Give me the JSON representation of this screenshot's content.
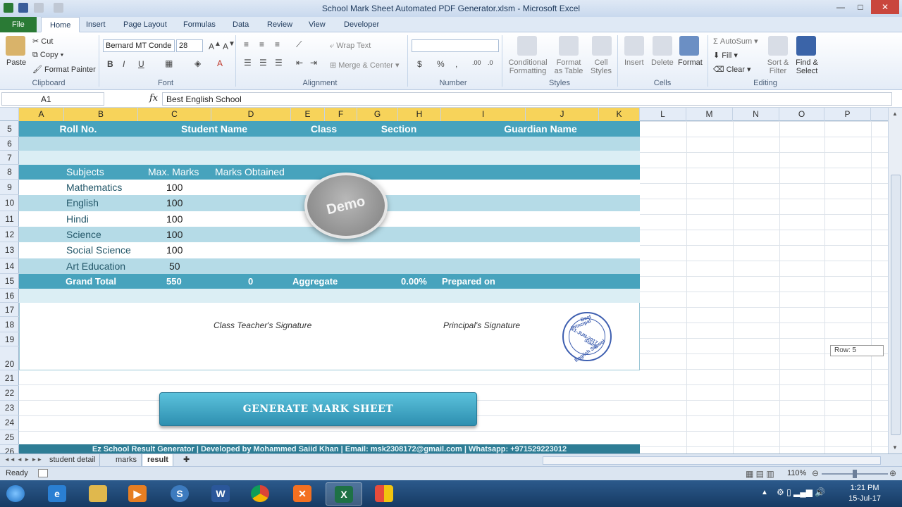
{
  "window": {
    "title": "School Mark Sheet Automated PDF Generator.xlsm  -  Microsoft Excel",
    "minimize": "—",
    "maximize": "□",
    "close": "✕"
  },
  "tabs": [
    "File",
    "Home",
    "Insert",
    "Page Layout",
    "Formulas",
    "Data",
    "Review",
    "View",
    "Developer"
  ],
  "ribbon": {
    "clipboard": {
      "paste": "Paste",
      "cut": "Cut",
      "copy": "Copy",
      "format_painter": "Format Painter",
      "label": "Clipboard"
    },
    "font": {
      "name": "Bernard MT Conde",
      "size": "28",
      "label": "Font",
      "bold": "B",
      "italic": "I",
      "underline": "U"
    },
    "alignment": {
      "wrap": "Wrap Text",
      "merge": "Merge & Center",
      "label": "Alignment"
    },
    "number": {
      "currency": "$",
      "percent": "%",
      "comma": ",",
      "label": "Number"
    },
    "styles": {
      "conditional": "Conditional Formatting",
      "format_table": "Format as Table",
      "cell_styles": "Cell Styles",
      "label": "Styles"
    },
    "cells": {
      "insert": "Insert",
      "delete": "Delete",
      "format": "Format",
      "label": "Cells"
    },
    "editing": {
      "autosum": "AutoSum",
      "fill": "Fill",
      "clear": "Clear",
      "sort": "Sort & Filter",
      "find": "Find & Select",
      "label": "Editing"
    }
  },
  "formula_bar": {
    "cell_ref": "A1",
    "fx": "fx",
    "content": "Best English School"
  },
  "columns": [
    "A",
    "B",
    "C",
    "D",
    "E",
    "F",
    "G",
    "H",
    "I",
    "J",
    "K",
    "L",
    "M",
    "N",
    "O",
    "P"
  ],
  "rows": [
    "5",
    "6",
    "7",
    "8",
    "9",
    "10",
    "11",
    "12",
    "13",
    "14",
    "15",
    "16",
    "17",
    "18",
    "19",
    "20",
    "21",
    "22",
    "23",
    "24",
    "25",
    "26"
  ],
  "sheet": {
    "header": {
      "roll": "Roll No.",
      "name": "Student Name",
      "class": "Class",
      "section": "Section",
      "guardian": "Guardian Name"
    },
    "marks_header": {
      "subjects": "Subjects",
      "max": "Max. Marks",
      "obtained": "Marks Obtained"
    },
    "subjects": [
      {
        "name": "Mathematics",
        "max": "100"
      },
      {
        "name": "English",
        "max": "100"
      },
      {
        "name": "Hindi",
        "max": "100"
      },
      {
        "name": "Science",
        "max": "100"
      },
      {
        "name": "Social Science",
        "max": "100"
      },
      {
        "name": "Art Education",
        "max": "50"
      }
    ],
    "total": {
      "label": "Grand Total",
      "max": "550",
      "obtained": "0",
      "aggregate_label": "Aggregate",
      "aggregate": "0.00%",
      "prepared": "Prepared on"
    },
    "signatures": {
      "teacher": "Class Teacher's Signature",
      "principal": "Principal's Signature"
    },
    "stamp": {
      "line1": "Best",
      "line2": "Principal",
      "line3": "21-JUN-2017",
      "line4": "Stamp",
      "line5": "English School"
    },
    "demo": "Demo",
    "button": "GENERATE MARK SHEET",
    "footer": "Ez School Result Generator | Developed by Mohammed Saiid Khan | Email: msk2308172@gmail.com | Whatsapp: +971529223012",
    "row_tip": "Row: 5"
  },
  "sheet_tabs": [
    "student detail",
    "marks",
    "result"
  ],
  "status": {
    "ready": "Ready",
    "zoom": "110%"
  },
  "taskbar": {
    "time": "1:21 PM",
    "date": "15-Jul-17"
  },
  "colors": {
    "dark_band": "#47a3bd",
    "light_band": "#b5dbe7",
    "footer": "#2e7d95",
    "excel_green": "#2a7a35"
  }
}
